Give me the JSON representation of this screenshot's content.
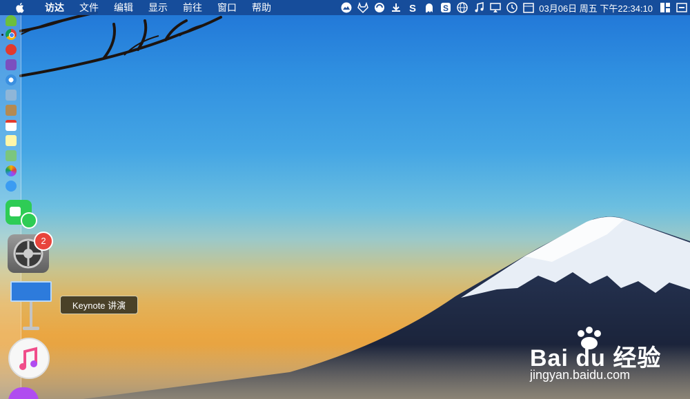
{
  "menubar": {
    "items": [
      "访达",
      "文件",
      "编辑",
      "显示",
      "前往",
      "窗口",
      "帮助"
    ],
    "clock": "03月06日 周五 下午22:34:10"
  },
  "dock": {
    "system_preferences_badge": "2",
    "tooltip": "Keynote 讲演"
  },
  "watermark": {
    "logo": "Bai du 经验",
    "url": "jingyan.baidu.com"
  }
}
